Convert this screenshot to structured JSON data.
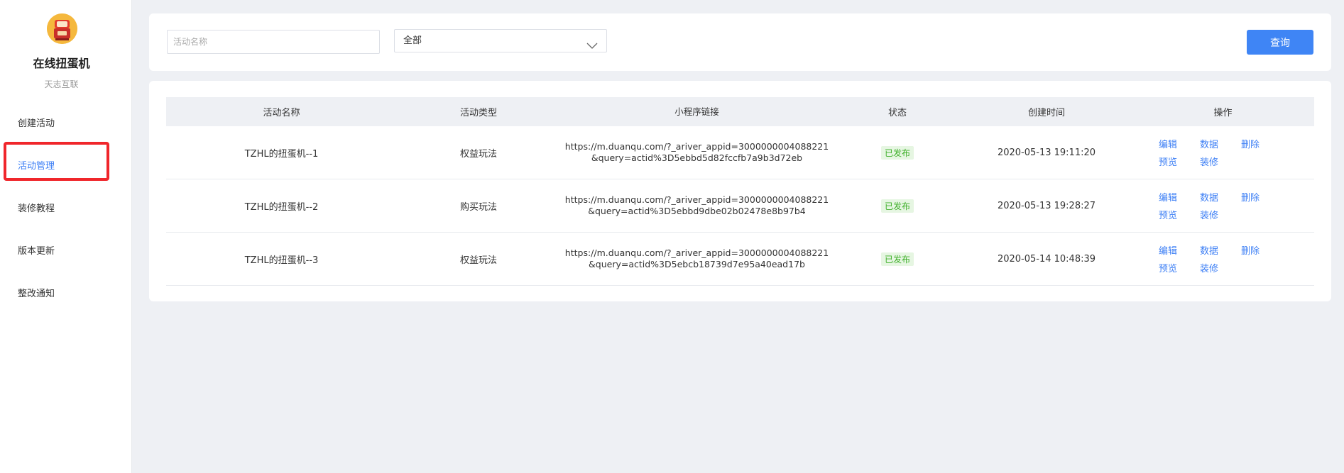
{
  "app": {
    "title": "在线扭蛋机",
    "subtitle": "天志互联",
    "logo_icon": "gashapon-machine-icon"
  },
  "sidebar": {
    "items": [
      {
        "label": "创建活动",
        "active": false
      },
      {
        "label": "活动管理",
        "active": true
      },
      {
        "label": "装修教程",
        "active": false
      },
      {
        "label": "版本更新",
        "active": false
      },
      {
        "label": "整改通知",
        "active": false
      }
    ]
  },
  "filter": {
    "name_placeholder": "活动名称",
    "name_value": "",
    "type_selected": "全部",
    "query_label": "查询"
  },
  "table": {
    "columns": [
      "活动名称",
      "活动类型",
      "小程序链接",
      "状态",
      "创建时间",
      "操作"
    ],
    "rows": [
      {
        "name": "TZHL的扭蛋机--1",
        "type": "权益玩法",
        "link_line1": "https://m.duanqu.com/?_ariver_appid=3000000004088221",
        "link_line2": "&query=actid%3D5ebbd5d82fccfb7a9b3d72eb",
        "status": "已发布",
        "created": "2020-05-13 19:11:20",
        "ops": [
          "编辑",
          "数据",
          "删除",
          "预览",
          "装修"
        ]
      },
      {
        "name": "TZHL的扭蛋机--2",
        "type": "购买玩法",
        "link_line1": "https://m.duanqu.com/?_ariver_appid=3000000004088221",
        "link_line2": "&query=actid%3D5ebbd9dbe02b02478e8b97b4",
        "status": "已发布",
        "created": "2020-05-13 19:28:27",
        "ops": [
          "编辑",
          "数据",
          "删除",
          "预览",
          "装修"
        ]
      },
      {
        "name": "TZHL的扭蛋机--3",
        "type": "权益玩法",
        "link_line1": "https://m.duanqu.com/?_ariver_appid=3000000004088221",
        "link_line2": "&query=actid%3D5ebcb18739d7e95a40ead17b",
        "status": "已发布",
        "created": "2020-05-14 10:48:39",
        "ops": [
          "编辑",
          "数据",
          "删除",
          "预览",
          "装修"
        ]
      }
    ]
  },
  "colors": {
    "accent": "#3f85f5",
    "link": "#3d7ff5",
    "status_green": "#3fb02a",
    "highlight_red": "#f0262b",
    "background": "#eef0f4"
  }
}
